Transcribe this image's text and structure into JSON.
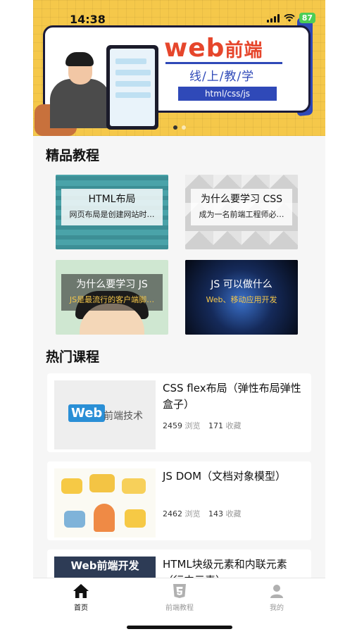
{
  "status_bar": {
    "time": "14:38",
    "battery": "87"
  },
  "banner": {
    "brand": "web",
    "brand_suffix": "前端",
    "subtitle": "线/上/教/学",
    "tag": "html/css/js"
  },
  "featured": {
    "title": "精品教程",
    "cards": [
      {
        "title": "HTML布局",
        "desc": "网页布局是创建网站时…"
      },
      {
        "title": "为什么要学习 CSS",
        "desc": "成为一名前端工程师必…"
      },
      {
        "title": "为什么要学习 JS",
        "desc": "JS是最流行的客户端脚…"
      },
      {
        "title": "JS 可以做什么",
        "desc": "Web、移动应用开发"
      }
    ]
  },
  "popular": {
    "title": "热门课程",
    "courses": [
      {
        "name": "CSS flex布局（弹性布局弹性盒子）",
        "views": "2459",
        "views_label": "浏览",
        "favs": "171",
        "favs_label": "收藏",
        "thumb_logo": "Web",
        "thumb_text": "前端技术"
      },
      {
        "name": "JS DOM（文档对象模型）",
        "views": "2462",
        "views_label": "浏览",
        "favs": "143",
        "favs_label": "收藏"
      },
      {
        "name": "HTML块级元素和内联元素（行内元素）",
        "thumb_text": "Web前端开发"
      }
    ]
  },
  "tabbar": {
    "items": [
      {
        "label": "首页",
        "icon": "home-icon",
        "active": true
      },
      {
        "label": "前端教程",
        "icon": "html5-icon",
        "active": false
      },
      {
        "label": "我的",
        "icon": "user-icon",
        "active": false
      }
    ]
  },
  "colors": {
    "accent": "#2f49b8",
    "brand_red": "#e6462c",
    "banner_bg": "#f5c84a"
  }
}
